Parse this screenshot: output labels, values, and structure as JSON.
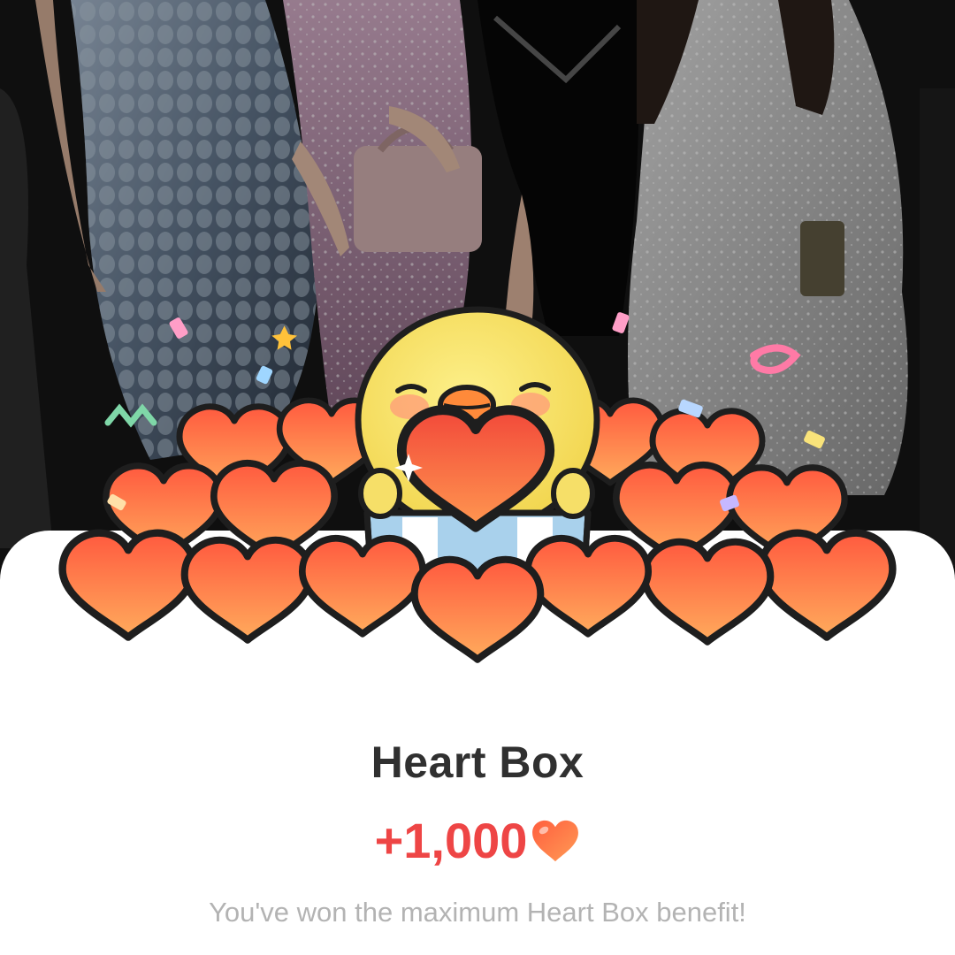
{
  "background": {
    "description_icon": "photo-background"
  },
  "illustration": {
    "icon": "chick-holding-heart-in-box-icon"
  },
  "sheet": {
    "title": "Heart Box",
    "amount": "+1,000",
    "amount_icon": "heart-icon",
    "subtitle": "You've won the maximum Heart Box benefit!"
  },
  "colors": {
    "accent": "#ee4545",
    "title": "#303030",
    "subtitle": "#b3b3b3",
    "heart_light": "#ff9a52",
    "heart_dark": "#f24a3a",
    "chick": "#f8e36a"
  }
}
